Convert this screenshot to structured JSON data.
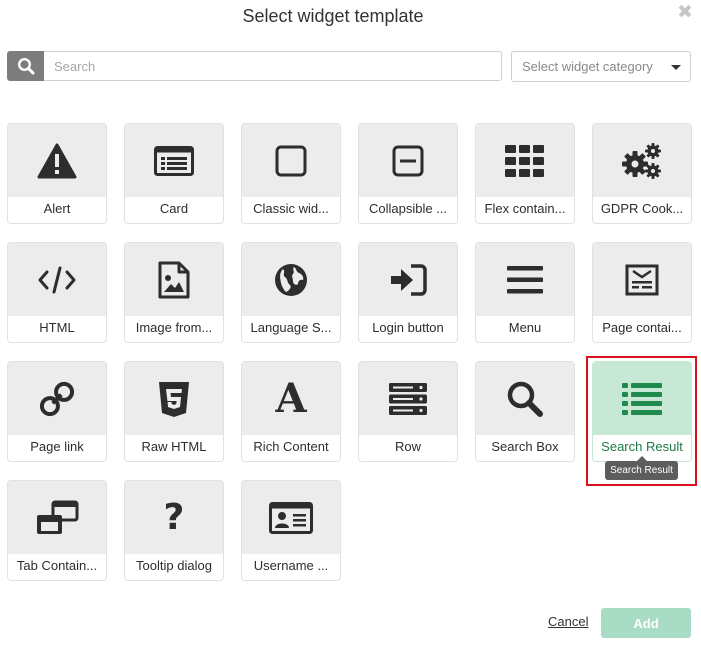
{
  "dialog": {
    "title": "Select widget template"
  },
  "search": {
    "placeholder": "Search",
    "value": ""
  },
  "category": {
    "selected": "Select widget category"
  },
  "widgets": [
    {
      "label": "Alert",
      "icon": "alert-icon"
    },
    {
      "label": "Card",
      "icon": "card-icon"
    },
    {
      "label": "Classic wid...",
      "icon": "square-icon"
    },
    {
      "label": "Collapsible ...",
      "icon": "collapse-icon"
    },
    {
      "label": "Flex contain...",
      "icon": "grid-icon"
    },
    {
      "label": "GDPR Cook...",
      "icon": "gears-icon"
    },
    {
      "label": "HTML",
      "icon": "code-icon"
    },
    {
      "label": "Image from...",
      "icon": "image-file-icon"
    },
    {
      "label": "Language S...",
      "icon": "globe-icon"
    },
    {
      "label": "Login button",
      "icon": "sign-in-icon"
    },
    {
      "label": "Menu",
      "icon": "menu-icon"
    },
    {
      "label": "Page contai...",
      "icon": "newspaper-icon"
    },
    {
      "label": "Page link",
      "icon": "link-icon"
    },
    {
      "label": "Raw HTML",
      "icon": "html5-icon"
    },
    {
      "label": "Rich Content",
      "icon": "font-icon"
    },
    {
      "label": "Row",
      "icon": "server-icon"
    },
    {
      "label": "Search Box",
      "icon": "search-icon"
    },
    {
      "label": "Search Result",
      "icon": "list-icon",
      "selected": true
    },
    {
      "label": "Tab Contain...",
      "icon": "windows-icon"
    },
    {
      "label": "Tooltip dialog",
      "icon": "question-icon"
    },
    {
      "label": "Username ...",
      "icon": "id-card-icon"
    }
  ],
  "tooltip": {
    "text": "Search Result"
  },
  "footer": {
    "cancel_label": "Cancel",
    "add_label": "Add"
  },
  "colors": {
    "selected_bg": "#c8e8d6",
    "selected_icon": "#1e8a4c",
    "highlight_border": "#d9121b",
    "add_button": "#a8dcc4",
    "icon_dark": "#2d2d2d"
  }
}
